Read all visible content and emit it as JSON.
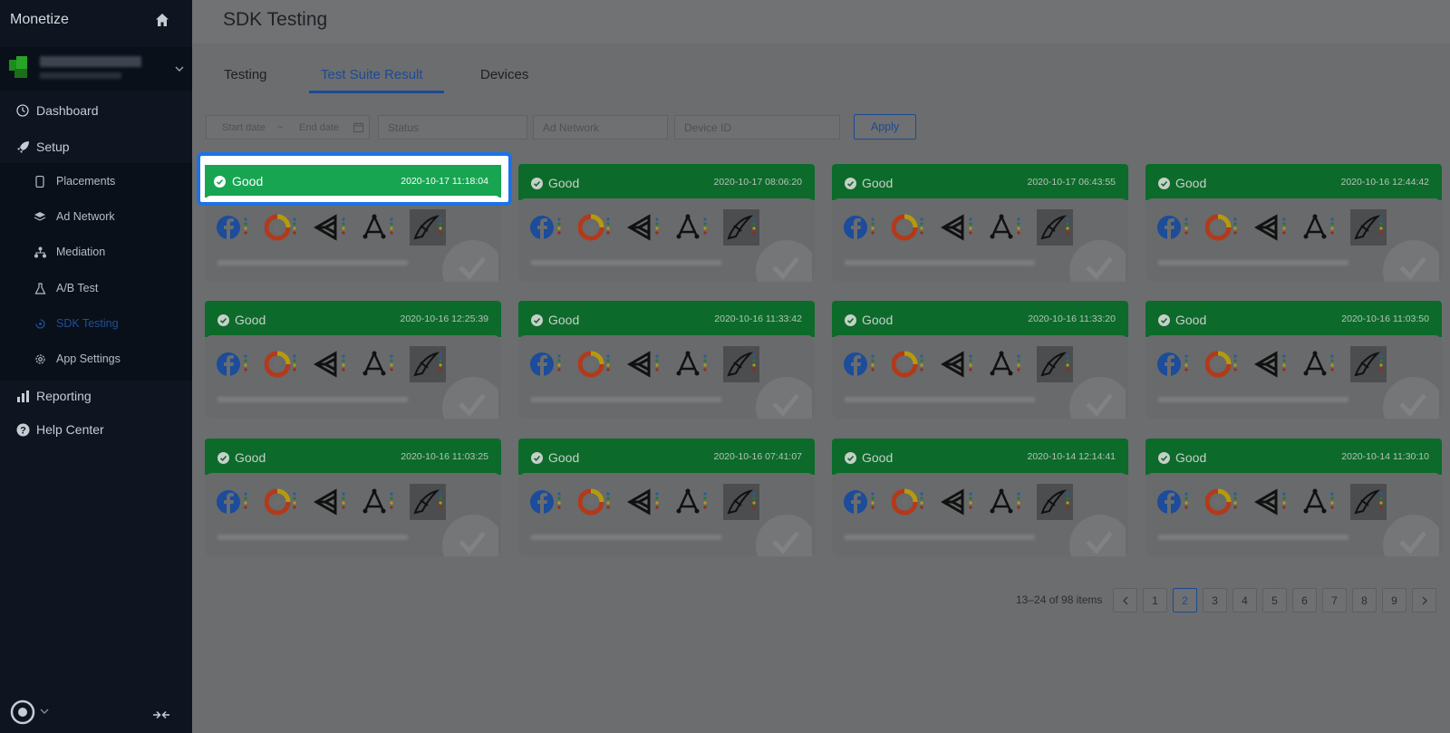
{
  "sidebar": {
    "brand": "Monetize",
    "nav": [
      {
        "label": "Dashboard",
        "icon": "dashboard-icon"
      },
      {
        "label": "Setup",
        "icon": "rocket-icon"
      },
      {
        "label": "Reporting",
        "icon": "bar-chart-icon"
      },
      {
        "label": "Help Center",
        "icon": "help-icon"
      }
    ],
    "setup_items": [
      {
        "label": "Placements",
        "icon": "phone-icon"
      },
      {
        "label": "Ad Network",
        "icon": "layers-icon"
      },
      {
        "label": "Mediation",
        "icon": "hierarchy-icon"
      },
      {
        "label": "A/B Test",
        "icon": "flask-icon"
      },
      {
        "label": "SDK Testing",
        "icon": "bug-icon",
        "active": true
      },
      {
        "label": "App Settings",
        "icon": "gear-icon"
      }
    ]
  },
  "header": {
    "title": "SDK Testing"
  },
  "tabs": [
    {
      "label": "Testing"
    },
    {
      "label": "Test Suite Result",
      "active": true
    },
    {
      "label": "Devices"
    }
  ],
  "filters": {
    "start_placeholder": "Start date",
    "separator": "~",
    "end_placeholder": "End date",
    "status_placeholder": "Status",
    "network_placeholder": "Ad Network",
    "device_placeholder": "Device ID",
    "apply_label": "Apply"
  },
  "cards": [
    {
      "status": "Good",
      "date": "2020-10-17 11:18:04"
    },
    {
      "status": "Good",
      "date": "2020-10-17 08:06:20"
    },
    {
      "status": "Good",
      "date": "2020-10-17 06:43:55"
    },
    {
      "status": "Good",
      "date": "2020-10-16 12:44:42"
    },
    {
      "status": "Good",
      "date": "2020-10-16 12:25:39"
    },
    {
      "status": "Good",
      "date": "2020-10-16 11:33:42"
    },
    {
      "status": "Good",
      "date": "2020-10-16 11:33:20"
    },
    {
      "status": "Good",
      "date": "2020-10-16 11:03:50"
    },
    {
      "status": "Good",
      "date": "2020-10-16 11:03:25"
    },
    {
      "status": "Good",
      "date": "2020-10-16 07:41:07"
    },
    {
      "status": "Good",
      "date": "2020-10-14 12:14:41"
    },
    {
      "status": "Good",
      "date": "2020-10-14 11:30:10"
    }
  ],
  "networks": [
    "facebook-icon",
    "admob-icon",
    "unity-icon",
    "applovin-icon",
    "ironsource-icon"
  ],
  "pagination": {
    "info": "13–24 of 98 items",
    "pages": [
      "1",
      "2",
      "3",
      "4",
      "5",
      "6",
      "7",
      "8",
      "9"
    ],
    "current": "2"
  },
  "colors": {
    "card_header": "#0c6b2a",
    "highlight": "#17a552",
    "accent": "#1d4a93",
    "focus_ring": "#1a73e8"
  }
}
